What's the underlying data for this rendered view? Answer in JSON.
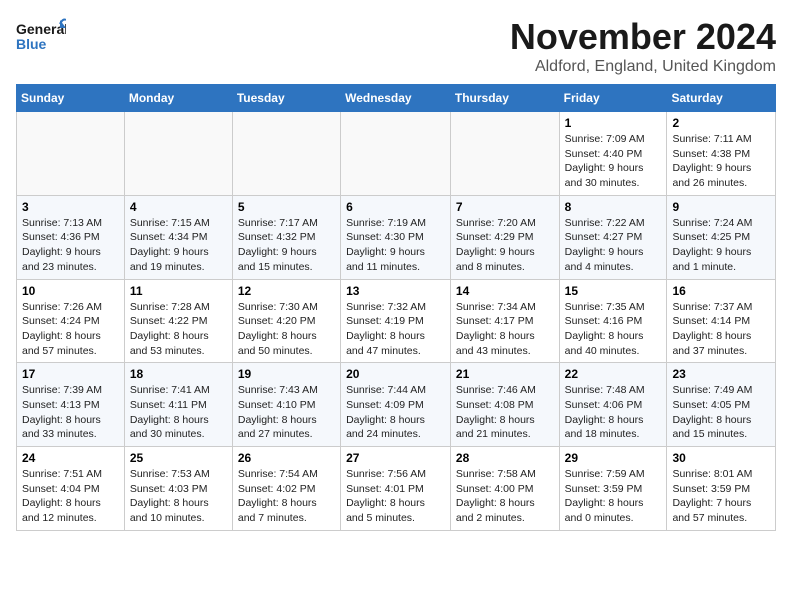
{
  "logo": {
    "text_general": "General",
    "text_blue": "Blue"
  },
  "title": "November 2024",
  "location": "Aldford, England, United Kingdom",
  "weekdays": [
    "Sunday",
    "Monday",
    "Tuesday",
    "Wednesday",
    "Thursday",
    "Friday",
    "Saturday"
  ],
  "weeks": [
    [
      {
        "day": "",
        "info": ""
      },
      {
        "day": "",
        "info": ""
      },
      {
        "day": "",
        "info": ""
      },
      {
        "day": "",
        "info": ""
      },
      {
        "day": "",
        "info": ""
      },
      {
        "day": "1",
        "info": "Sunrise: 7:09 AM\nSunset: 4:40 PM\nDaylight: 9 hours\nand 30 minutes."
      },
      {
        "day": "2",
        "info": "Sunrise: 7:11 AM\nSunset: 4:38 PM\nDaylight: 9 hours\nand 26 minutes."
      }
    ],
    [
      {
        "day": "3",
        "info": "Sunrise: 7:13 AM\nSunset: 4:36 PM\nDaylight: 9 hours\nand 23 minutes."
      },
      {
        "day": "4",
        "info": "Sunrise: 7:15 AM\nSunset: 4:34 PM\nDaylight: 9 hours\nand 19 minutes."
      },
      {
        "day": "5",
        "info": "Sunrise: 7:17 AM\nSunset: 4:32 PM\nDaylight: 9 hours\nand 15 minutes."
      },
      {
        "day": "6",
        "info": "Sunrise: 7:19 AM\nSunset: 4:30 PM\nDaylight: 9 hours\nand 11 minutes."
      },
      {
        "day": "7",
        "info": "Sunrise: 7:20 AM\nSunset: 4:29 PM\nDaylight: 9 hours\nand 8 minutes."
      },
      {
        "day": "8",
        "info": "Sunrise: 7:22 AM\nSunset: 4:27 PM\nDaylight: 9 hours\nand 4 minutes."
      },
      {
        "day": "9",
        "info": "Sunrise: 7:24 AM\nSunset: 4:25 PM\nDaylight: 9 hours\nand 1 minute."
      }
    ],
    [
      {
        "day": "10",
        "info": "Sunrise: 7:26 AM\nSunset: 4:24 PM\nDaylight: 8 hours\nand 57 minutes."
      },
      {
        "day": "11",
        "info": "Sunrise: 7:28 AM\nSunset: 4:22 PM\nDaylight: 8 hours\nand 53 minutes."
      },
      {
        "day": "12",
        "info": "Sunrise: 7:30 AM\nSunset: 4:20 PM\nDaylight: 8 hours\nand 50 minutes."
      },
      {
        "day": "13",
        "info": "Sunrise: 7:32 AM\nSunset: 4:19 PM\nDaylight: 8 hours\nand 47 minutes."
      },
      {
        "day": "14",
        "info": "Sunrise: 7:34 AM\nSunset: 4:17 PM\nDaylight: 8 hours\nand 43 minutes."
      },
      {
        "day": "15",
        "info": "Sunrise: 7:35 AM\nSunset: 4:16 PM\nDaylight: 8 hours\nand 40 minutes."
      },
      {
        "day": "16",
        "info": "Sunrise: 7:37 AM\nSunset: 4:14 PM\nDaylight: 8 hours\nand 37 minutes."
      }
    ],
    [
      {
        "day": "17",
        "info": "Sunrise: 7:39 AM\nSunset: 4:13 PM\nDaylight: 8 hours\nand 33 minutes."
      },
      {
        "day": "18",
        "info": "Sunrise: 7:41 AM\nSunset: 4:11 PM\nDaylight: 8 hours\nand 30 minutes."
      },
      {
        "day": "19",
        "info": "Sunrise: 7:43 AM\nSunset: 4:10 PM\nDaylight: 8 hours\nand 27 minutes."
      },
      {
        "day": "20",
        "info": "Sunrise: 7:44 AM\nSunset: 4:09 PM\nDaylight: 8 hours\nand 24 minutes."
      },
      {
        "day": "21",
        "info": "Sunrise: 7:46 AM\nSunset: 4:08 PM\nDaylight: 8 hours\nand 21 minutes."
      },
      {
        "day": "22",
        "info": "Sunrise: 7:48 AM\nSunset: 4:06 PM\nDaylight: 8 hours\nand 18 minutes."
      },
      {
        "day": "23",
        "info": "Sunrise: 7:49 AM\nSunset: 4:05 PM\nDaylight: 8 hours\nand 15 minutes."
      }
    ],
    [
      {
        "day": "24",
        "info": "Sunrise: 7:51 AM\nSunset: 4:04 PM\nDaylight: 8 hours\nand 12 minutes."
      },
      {
        "day": "25",
        "info": "Sunrise: 7:53 AM\nSunset: 4:03 PM\nDaylight: 8 hours\nand 10 minutes."
      },
      {
        "day": "26",
        "info": "Sunrise: 7:54 AM\nSunset: 4:02 PM\nDaylight: 8 hours\nand 7 minutes."
      },
      {
        "day": "27",
        "info": "Sunrise: 7:56 AM\nSunset: 4:01 PM\nDaylight: 8 hours\nand 5 minutes."
      },
      {
        "day": "28",
        "info": "Sunrise: 7:58 AM\nSunset: 4:00 PM\nDaylight: 8 hours\nand 2 minutes."
      },
      {
        "day": "29",
        "info": "Sunrise: 7:59 AM\nSunset: 3:59 PM\nDaylight: 8 hours\nand 0 minutes."
      },
      {
        "day": "30",
        "info": "Sunrise: 8:01 AM\nSunset: 3:59 PM\nDaylight: 7 hours\nand 57 minutes."
      }
    ]
  ]
}
